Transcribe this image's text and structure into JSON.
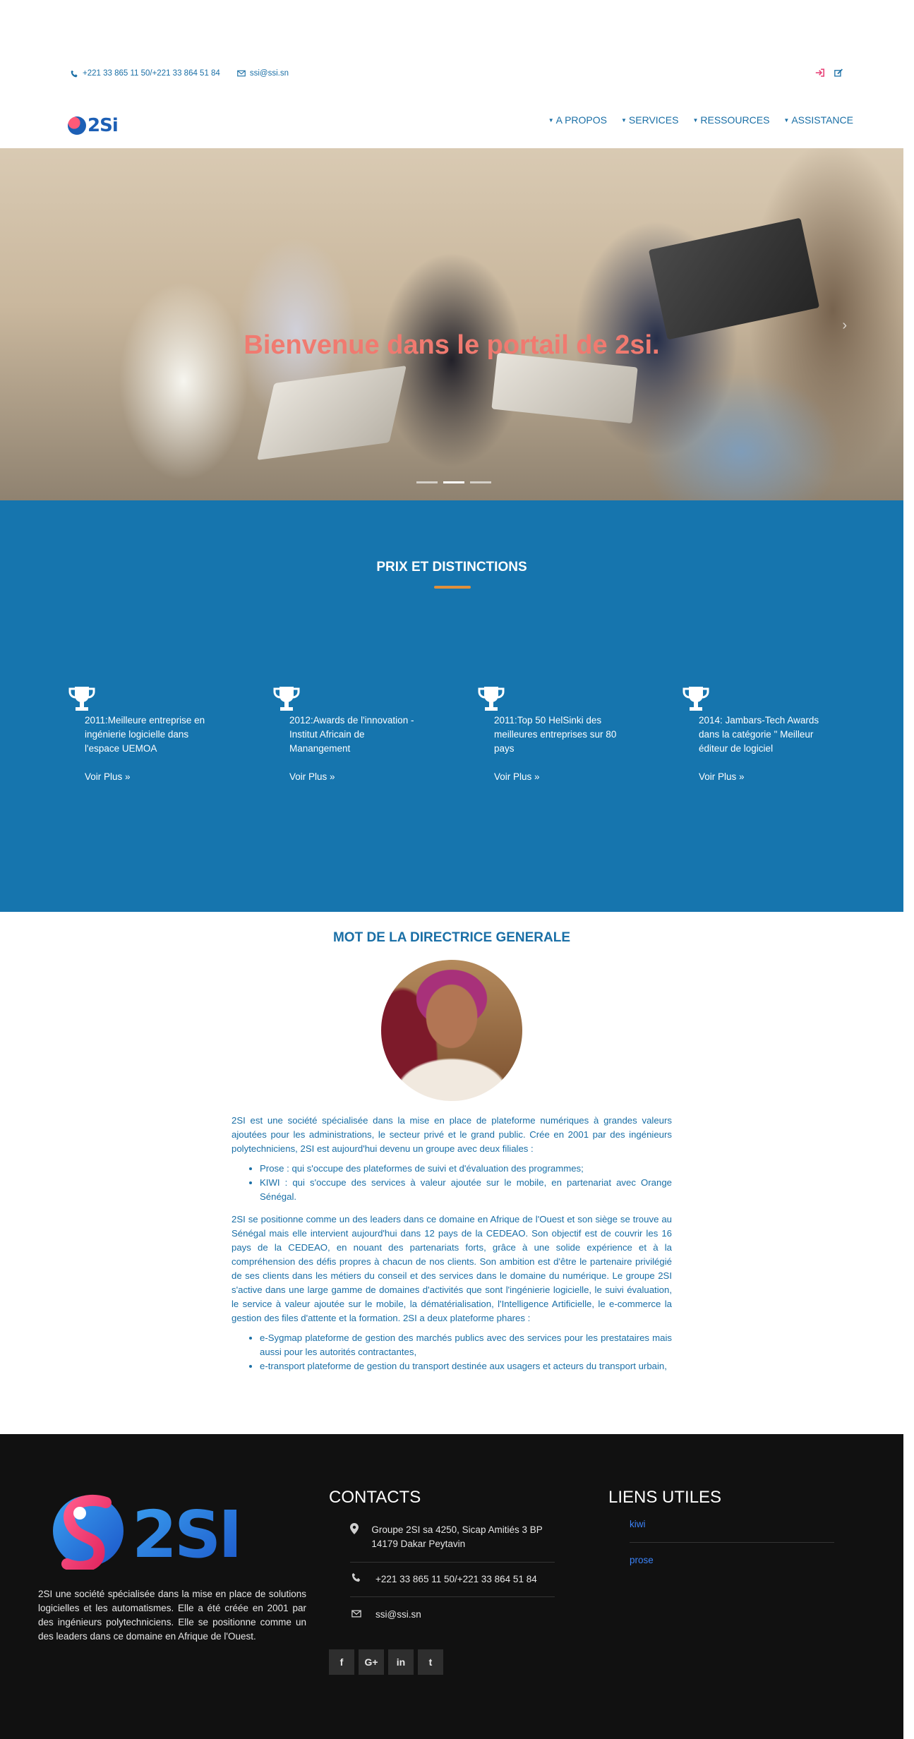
{
  "topbar": {
    "phone": "+221 33 865 11 50/+221 33 864 51 84",
    "email": "ssi@ssi.sn",
    "icons": [
      "login-icon",
      "edit-icon"
    ],
    "icon_color": "#e8477b"
  },
  "nav": {
    "logo_text": "2Si",
    "items": [
      {
        "label": "A PROPOS"
      },
      {
        "label": "SERVICES"
      },
      {
        "label": "RESSOURCES"
      },
      {
        "label": "ASSISTANCE"
      }
    ]
  },
  "hero": {
    "title": "Bienvenue dans le portail de 2si.",
    "title_color": "#f07a70",
    "slides": 3,
    "active_slide": 1
  },
  "awards": {
    "title": "PRIX ET DISTINCTIONS",
    "bg_color": "#1675ae",
    "accent": "#e08f3a",
    "items": [
      {
        "title": "2011:Meilleure entreprise en ingénierie logicielle dans l'espace UEMOA",
        "more": "Voir Plus »"
      },
      {
        "title": "2012:Awards de l'innovation - Institut Africain de Manangement",
        "more": "Voir Plus »"
      },
      {
        "title": "2011:Top 50 HelSinki des meilleures entreprises sur 80 pays",
        "more": "Voir Plus »"
      },
      {
        "title": "2014: Jambars-Tech Awards dans la catégorie \" Meilleur éditeur de logiciel",
        "more": "Voir Plus »"
      }
    ]
  },
  "director": {
    "title": "MOT DE LA DIRECTRICE GENERALE",
    "intro": "2SI est une société spécialisée dans la mise en place de plateforme numériques à grandes valeurs ajoutées pour les administrations, le secteur privé et le grand public. Crée en 2001 par des ingénieurs polytechniciens, 2SI est aujourd'hui devenu un groupe avec deux filiales :",
    "subsidiaries": [
      "Prose : qui s'occupe des plateformes de suivi et d'évaluation des programmes;",
      "KIWI : qui s'occupe des services à valeur ajoutée sur le mobile, en partenariat avec Orange Sénégal."
    ],
    "body": "2SI se positionne comme un des leaders dans ce domaine en Afrique de l'Ouest et son siège se trouve au Sénégal mais elle intervient aujourd'hui dans 12 pays de la CEDEAO. Son objectif est de couvrir les 16 pays de la CEDEAO, en nouant des partenariats forts, grâce à une solide expérience et à la compréhension des défis propres à chacun de nos clients. Son ambition est d'être le partenaire privilégié de ses clients dans les métiers du conseil et des services dans le domaine du numérique. Le groupe 2SI s'active dans une large gamme de domaines d'activités que sont l'ingénierie logicielle, le suivi évaluation, le service à valeur ajoutée sur le mobile, la dématérialisation, l'Intelligence Artificielle, le e-commerce la gestion des files d'attente et la formation. 2SI a deux plateforme phares :",
    "platforms": [
      "e-Sygmap plateforme de gestion des marchés publics avec des services pour les prestataires mais aussi pour les autorités contractantes,",
      "e-transport plateforme de gestion du transport destinée aux usagers et acteurs du transport urbain,"
    ]
  },
  "footer": {
    "logo_text": "2SI",
    "description": "2SI une société spécialisée dans la mise en place de solutions logicielles et les automatismes. Elle a été créée en 2001 par des ingénieurs polytechniciens. Elle se positionne comme un des leaders dans ce domaine en Afrique de l'Ouest.",
    "contacts_title": "CONTACTS",
    "address": "Groupe 2SI sa 4250, Sicap Amitiés 3 BP 14179 Dakar Peytavin",
    "phone": "+221 33 865 11 50/+221 33 864 51 84",
    "email": "ssi@ssi.sn",
    "social": [
      {
        "icon": "facebook-icon",
        "glyph": "f"
      },
      {
        "icon": "google-plus-icon",
        "glyph": "G+"
      },
      {
        "icon": "linkedin-icon",
        "glyph": "in"
      },
      {
        "icon": "twitter-icon",
        "glyph": "t"
      }
    ],
    "links_title": "LIENS UTILES",
    "links": [
      "kiwi",
      "prose"
    ]
  }
}
